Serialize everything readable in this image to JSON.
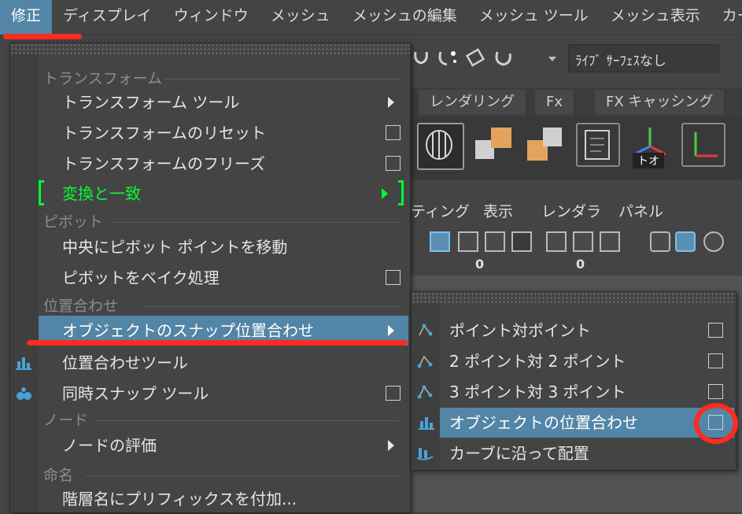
{
  "menubar": {
    "items": [
      "修正",
      "ディスプレイ",
      "ウィンドウ",
      "メッシュ",
      "メッシュの編集",
      "メッシュ ツール",
      "メッシュ表示",
      "カーブ"
    ]
  },
  "background": {
    "live_surface": "ﾗｲﾌﾞ ｻｰﾌｪｽなし",
    "tabs": [
      "レンダリング",
      "Fx",
      "FX キャッシング"
    ],
    "panel_menu": [
      "ティング",
      "表示",
      "レンダラ",
      "パネル"
    ],
    "counters": [
      "0",
      "0"
    ],
    "shelf_badge": "トオ"
  },
  "menu": {
    "sections": {
      "transform": "トランスフォーム",
      "pivot": "ピボット",
      "align": "位置合わせ",
      "node": "ノード",
      "naming": "命名"
    },
    "items": {
      "transform_tool": "トランスフォーム ツール",
      "reset_transform": "トランスフォームのリセット",
      "freeze_transform": "トランスフォームのフリーズ",
      "match_transform": "変換と一致",
      "center_pivot": "中央にピボット ポイントを移動",
      "bake_pivot": "ピボットをベイク処理",
      "snap_align_objects": "オブジェクトのスナップ位置合わせ",
      "align_tool": "位置合わせツール",
      "snap_together_tool": "同時スナップ ツール",
      "evaluate_nodes": "ノードの評価",
      "prefix_hierarchy": "階層名にプリフィックスを付加..."
    }
  },
  "submenu": {
    "items": [
      "ポイント対ポイント",
      "2 ポイント対 2 ポイント",
      "3 ポイント対 3 ポイント",
      "オブジェクトの位置合わせ",
      "カーブに沿って配置"
    ]
  },
  "colors": {
    "highlight": "#5285a6",
    "annotation": "#ff2b1e",
    "green_marker": "#00ff33"
  }
}
